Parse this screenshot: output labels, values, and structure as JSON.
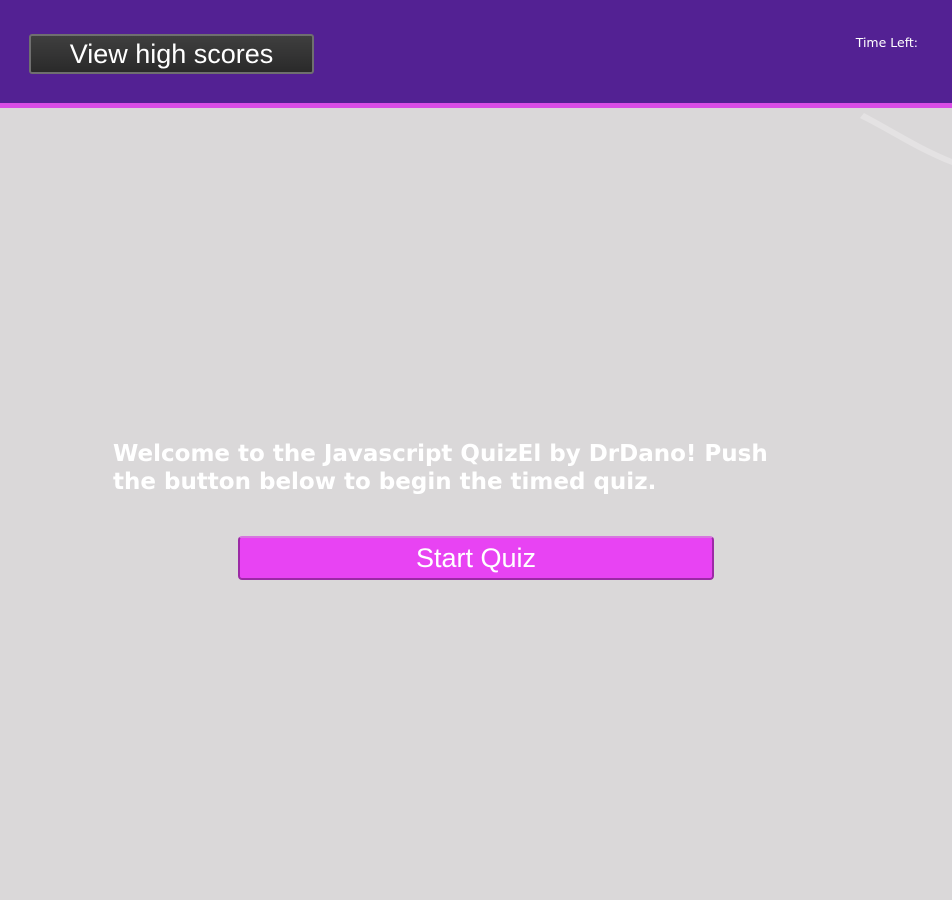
{
  "header": {
    "highscores_label": "View high scores",
    "timer_label": "Time Left:",
    "timer_value": ""
  },
  "main": {
    "welcome_text": "Welcome to the Javascript QuizEl by DrDano! Push the button below to begin the timed quiz.",
    "start_label": "Start Quiz"
  },
  "colors": {
    "header_bg": "#532193",
    "header_accent": "#d94ce6",
    "page_bg": "#dad8d9",
    "start_button": "#e843f3",
    "highscores_button": "#333333"
  }
}
